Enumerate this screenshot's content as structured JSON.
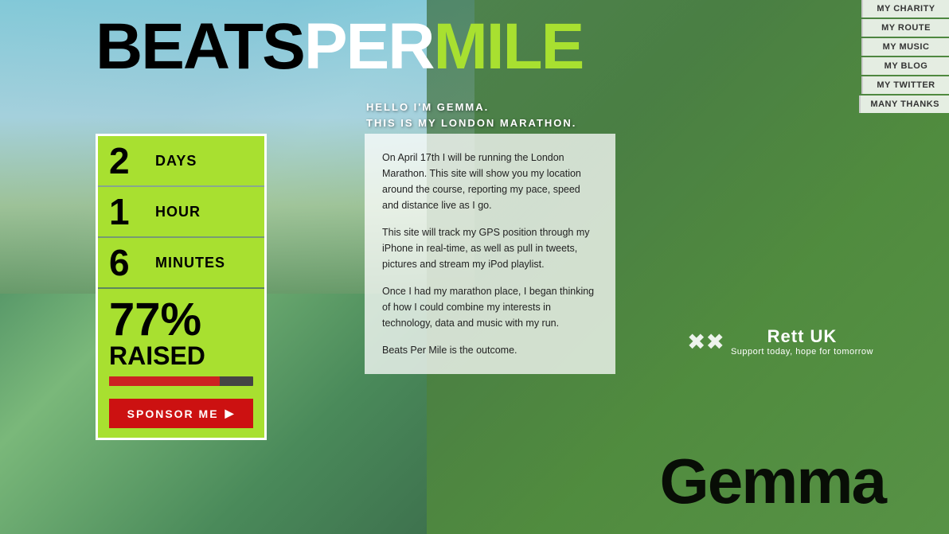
{
  "meta": {
    "title": "Beats Per Mile"
  },
  "logo": {
    "beats": "BEATS",
    "per": "PER",
    "mile": "MILE"
  },
  "tagline": {
    "line1": "HELLO I'M GEMMA.",
    "line2": "THIS IS MY LONDON MARATHON."
  },
  "nav": {
    "items": [
      {
        "id": "my-charity",
        "label": "MY CHARITY"
      },
      {
        "id": "my-route",
        "label": "MY ROUTE"
      },
      {
        "id": "my-music",
        "label": "MY MUSIC"
      },
      {
        "id": "my-blog",
        "label": "MY BLOG"
      },
      {
        "id": "my-twitter",
        "label": "MY TWITTER"
      },
      {
        "id": "many-thanks",
        "label": "MANY THANKS"
      }
    ]
  },
  "countdown": {
    "days": {
      "value": "2",
      "label": "DAYS"
    },
    "hours": {
      "value": "1",
      "label": "HOUR"
    },
    "minutes": {
      "value": "6",
      "label": "MINUTES"
    }
  },
  "fundraising": {
    "percent": "77%",
    "label": "RAISED",
    "progress": 77,
    "sponsor_label": "SPONSOR ME"
  },
  "info": {
    "paragraph1": "On April 17th I will be running the London Marathon. This site will show you my location around the course, reporting my pace, speed and distance live as I go.",
    "paragraph2": "This site will track my GPS position through my iPhone in real-time, as well as pull in tweets, pictures and stream my iPod playlist.",
    "paragraph3": "Once I had my marathon place, I began thinking of how I could combine my interests in technology, data and music with my run.",
    "paragraph4": "Beats Per Mile is the outcome."
  },
  "charity": {
    "name": "Rett UK",
    "tagline": "Support today, hope for tomorrow"
  },
  "runner": {
    "name": "Gemma"
  },
  "colors": {
    "accent_green": "#a8e030",
    "accent_red": "#cc1111",
    "nav_bg": "rgba(255,255,255,0.85)"
  }
}
